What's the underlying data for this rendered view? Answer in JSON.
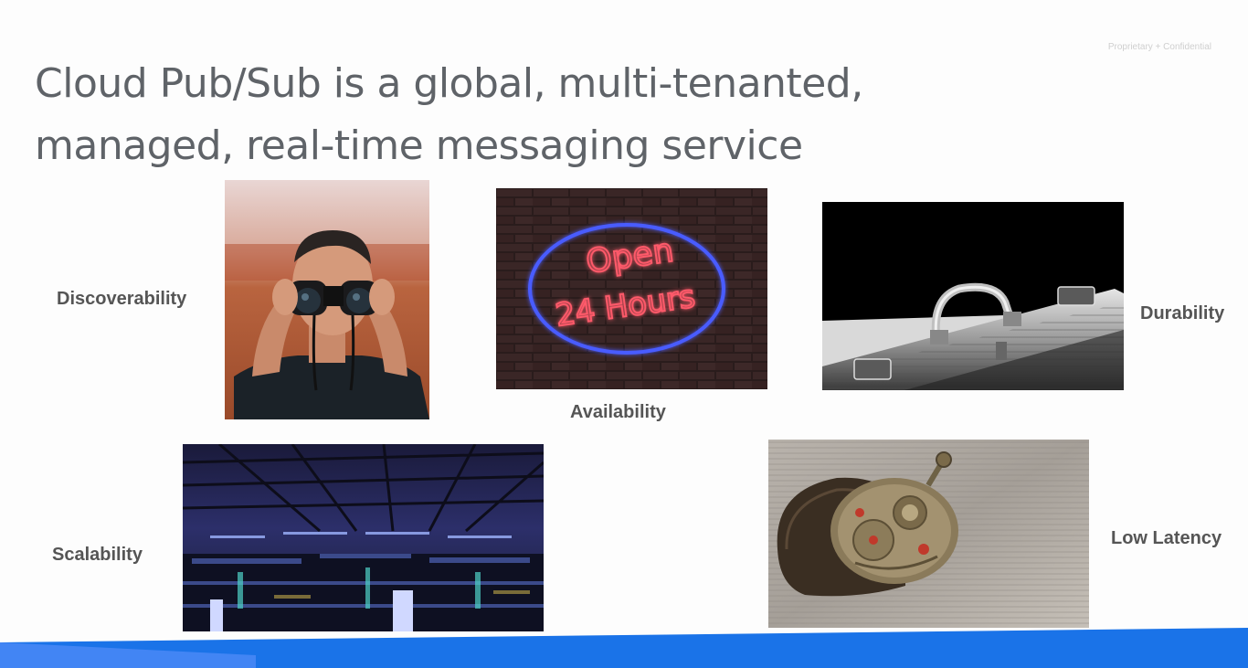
{
  "slide": {
    "confidential_note": "Proprietary + Confidential",
    "title_line1": "Cloud Pub/Sub is a global, multi-tenanted,",
    "title_line2": "managed, real-time messaging service",
    "features": {
      "discoverability": "Discoverability",
      "availability": "Availability",
      "durability": "Durability",
      "scalability": "Scalability",
      "low_latency": "Low Latency"
    },
    "neon_sign": {
      "line1": "Open",
      "line2": "24 Hours"
    },
    "images": {
      "discoverability": "binoculars-person-image",
      "availability": "neon-open-24-hours-image",
      "durability": "metal-briefcase-image",
      "scalability": "data-center-image",
      "low_latency": "watch-movement-image"
    },
    "colors": {
      "title": "#5f6368",
      "label": "#555555",
      "footer_blue": "#1a73e8",
      "neon_red": "#ff5a6a",
      "neon_blue": "#4a5cff"
    }
  }
}
